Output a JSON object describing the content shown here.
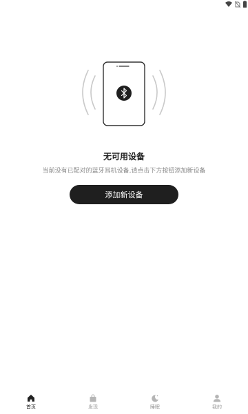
{
  "status_bar": {
    "icons": [
      "wifi-icon",
      "no-sim-icon",
      "battery-icon"
    ],
    "battery_level": 0.9
  },
  "empty_state": {
    "icon": "bluetooth-icon",
    "title": "无可用设备",
    "description": "当前没有已配对的蓝牙耳机设备,请点击下方按钮添加新设备"
  },
  "add_button": {
    "label": "添加新设备"
  },
  "tabs": [
    {
      "label": "首页",
      "icon": "home-icon",
      "active": true
    },
    {
      "label": "发现",
      "icon": "bag-icon",
      "active": false
    },
    {
      "label": "睡眠",
      "icon": "moon-icon",
      "active": false
    },
    {
      "label": "我的",
      "icon": "profile-icon",
      "active": false
    }
  ],
  "colors": {
    "primary": "#1f1f1f",
    "muted_text": "#8a8a8a",
    "inactive_tab": "#9a9a9a"
  }
}
